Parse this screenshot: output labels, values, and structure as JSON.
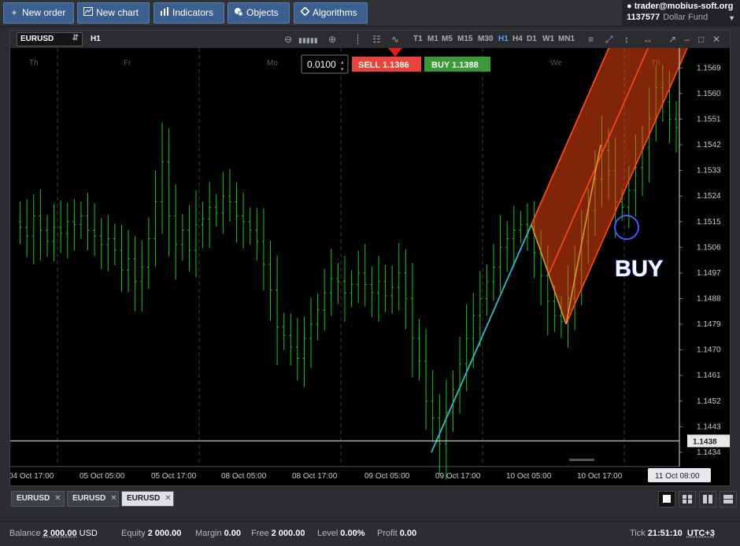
{
  "toolbar": {
    "new_order": "New order",
    "new_chart": "New chart",
    "indicators": "Indicators",
    "objects": "Objects",
    "algorithms": "Algorithms"
  },
  "account": {
    "user": "trader@mobius-soft.org",
    "number": "1137577",
    "fund": "Dollar Fund"
  },
  "chart": {
    "symbol": "EURUSD",
    "timeframe": "H1",
    "volume": "0.0100",
    "sell_label": "SELL",
    "sell_price": "1.1386",
    "buy_label": "BUY",
    "buy_price": "1.1388",
    "timeframes": [
      "T1",
      "M1",
      "M5",
      "M15",
      "M30",
      "H1",
      "H4",
      "D1",
      "W1",
      "MN1"
    ],
    "active_timeframe": "H1",
    "annotation": "BUY",
    "colors": {
      "bull": "#19c519",
      "channel": "#ff4a12",
      "trend": "#22b9c9",
      "fib": "#e0952a",
      "circle": "#3b5bff",
      "sell": "#e8443a",
      "buy": "#3a9a3a"
    }
  },
  "chart_data": {
    "type": "candlestick",
    "symbol": "EURUSD",
    "timeframe": "H1",
    "ylim": [
      1.1429,
      1.1576
    ],
    "y_ticks": [
      1.1569,
      1.156,
      1.1551,
      1.1542,
      1.1533,
      1.1524,
      1.1515,
      1.1506,
      1.1497,
      1.1488,
      1.1479,
      1.147,
      1.1461,
      1.1452,
      1.1443,
      1.1434
    ],
    "x_ticks": [
      "04 Oct 17:00",
      "05 Oct 05:00",
      "05 Oct 17:00",
      "08 Oct 05:00",
      "08 Oct 17:00",
      "09 Oct 05:00",
      "09 Oct 17:00",
      "10 Oct 05:00",
      "10 Oct 17:00"
    ],
    "x_current": "11 Oct 08:00",
    "day_labels": [
      "Th",
      "Fr",
      "Mo",
      "We",
      "Th"
    ],
    "current_price": 1.1438,
    "price_path": [
      1.1515,
      1.1513,
      1.151,
      1.1517,
      1.1512,
      1.1508,
      1.1513,
      1.1511,
      1.1515,
      1.1514,
      1.1517,
      1.1512,
      1.151,
      1.1507,
      1.1509,
      1.1505,
      1.1498,
      1.1502,
      1.1494,
      1.1499,
      1.1509,
      1.1522,
      1.1536,
      1.1517,
      1.1507,
      1.1512,
      1.1505,
      1.1514,
      1.1516,
      1.152,
      1.1518,
      1.1524,
      1.1522,
      1.1517,
      1.1515,
      1.1512,
      1.1508,
      1.15,
      1.1491,
      1.1478,
      1.1475,
      1.1471,
      1.1467,
      1.1474,
      1.1479,
      1.1484,
      1.149,
      1.1495,
      1.1494,
      1.149,
      1.1493,
      1.1497,
      1.1493,
      1.149,
      1.1494,
      1.1489,
      1.1492,
      1.1497,
      1.1488,
      1.1474,
      1.1466,
      1.1452,
      1.1446,
      1.1437,
      1.1448,
      1.1456,
      1.1465,
      1.1474,
      1.1482,
      1.1488,
      1.1494,
      1.1499,
      1.1506,
      1.1509,
      1.1512,
      1.1514,
      1.1511,
      1.1504,
      1.1496,
      1.1487,
      1.1482,
      1.148,
      1.1488,
      1.1498,
      1.1508,
      1.1519,
      1.153,
      1.154,
      1.1533,
      1.1522,
      1.152,
      1.1526,
      1.1534,
      1.1541,
      1.1551,
      1.1562,
      1.1557,
      1.1551,
      1.1548
    ]
  },
  "tabs": [
    {
      "label": "EURUSD"
    },
    {
      "label": "EURUSD"
    },
    {
      "label": "EURUSD"
    }
  ],
  "status": {
    "balance_label": "Balance",
    "balance_value": "2 000.00",
    "balance_ccy": "USD",
    "equity_label": "Equity",
    "equity_value": "2 000.00",
    "margin_label": "Margin",
    "margin_value": "0.00",
    "free_label": "Free",
    "free_value": "2 000.00",
    "level_label": "Level",
    "level_value": "0.00%",
    "profit_label": "Profit",
    "profit_value": "0.00",
    "tick_label": "Tick",
    "tick_time": "21:51:10",
    "utc": "UTC+3"
  }
}
